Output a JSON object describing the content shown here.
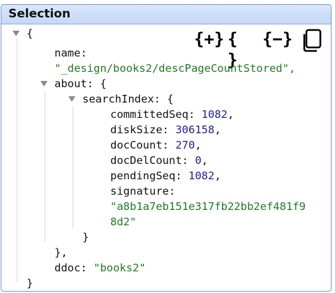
{
  "panel": {
    "title": "Selection"
  },
  "toolbar": {
    "expand_all_label": "{+}",
    "braces_label": "{ }",
    "collapse_all_label": "{−}",
    "copy_icon": "copy-icon"
  },
  "json_view": {
    "open_root": "{",
    "name_key": "name:",
    "name_value": "\"_design/books2/descPageCountStored\",",
    "about_key": "about: {",
    "search_index_key": "searchIndex: {",
    "fields": [
      {
        "key": "committedSeq: ",
        "value": "1082",
        "suffix": ","
      },
      {
        "key": "diskSize: ",
        "value": "306158",
        "suffix": ","
      },
      {
        "key": "docCount: ",
        "value": "270",
        "suffix": ","
      },
      {
        "key": "docDelCount: ",
        "value": "0",
        "suffix": ","
      },
      {
        "key": "pendingSeq: ",
        "value": "1082",
        "suffix": ","
      }
    ],
    "signature_key": "signature:",
    "signature_line1": "\"a8b1a7eb151e317fb22bb2ef481f9",
    "signature_line2": "8d2\"",
    "close_search_index": "}",
    "close_about": "},",
    "ddoc_key": "ddoc: ",
    "ddoc_value": "\"books2\"",
    "close_root": "}"
  }
}
